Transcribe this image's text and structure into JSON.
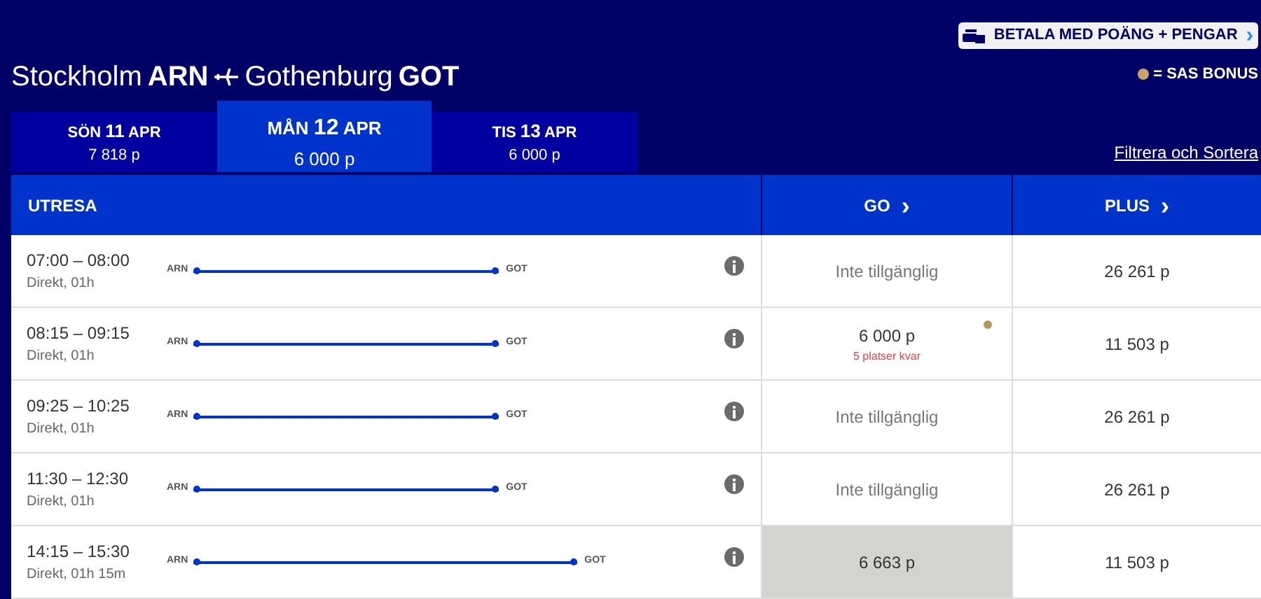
{
  "pay_button": {
    "label": "BETALA MED POÄNG + PENGAR",
    "chevron": "›"
  },
  "bonus_legend": {
    "label": "= SAS BONUS"
  },
  "route": {
    "origin_city": "Stockholm",
    "origin_code": "ARN",
    "destination_city": "Gothenburg",
    "destination_code": "GOT"
  },
  "date_tabs": [
    {
      "day": "SÖN",
      "date": "11",
      "month": "APR",
      "price": "7 818 p",
      "selected": false
    },
    {
      "day": "MÅN",
      "date": "12",
      "month": "APR",
      "price": "6 000 p",
      "selected": true
    },
    {
      "day": "TIS",
      "date": "13",
      "month": "APR",
      "price": "6 000 p",
      "selected": false
    }
  ],
  "filter_link": "Filtrera och Sortera",
  "table": {
    "columns": [
      {
        "label": "UTRESA"
      },
      {
        "label": "GO",
        "chevron": "›"
      },
      {
        "label": "PLUS",
        "chevron": "›"
      }
    ],
    "rows": [
      {
        "time": "07:00 – 08:00",
        "info": "Direkt, 01h",
        "from": "ARN",
        "to": "GOT",
        "kind": "short",
        "go": {
          "text": "Inte tillgänglig",
          "available": false,
          "selected": false,
          "bonus": false
        },
        "plus": "26 261 p"
      },
      {
        "time": "08:15 – 09:15",
        "info": "Direkt, 01h",
        "from": "ARN",
        "to": "GOT",
        "kind": "short",
        "go": {
          "text": "6 000 p",
          "available": true,
          "selected": false,
          "bonus": true,
          "note": "5 platser kvar"
        },
        "plus": "11 503 p"
      },
      {
        "time": "09:25 – 10:25",
        "info": "Direkt, 01h",
        "from": "ARN",
        "to": "GOT",
        "kind": "short",
        "go": {
          "text": "Inte tillgänglig",
          "available": false,
          "selected": false,
          "bonus": false
        },
        "plus": "26 261 p"
      },
      {
        "time": "11:30 – 12:30",
        "info": "Direkt, 01h",
        "from": "ARN",
        "to": "GOT",
        "kind": "short",
        "go": {
          "text": "Inte tillgänglig",
          "available": false,
          "selected": false,
          "bonus": false
        },
        "plus": "26 261 p"
      },
      {
        "time": "14:15 – 15:30",
        "info": "Direkt, 01h 15m",
        "from": "ARN",
        "to": "GOT",
        "kind": "long",
        "go": {
          "text": "6 663 p",
          "available": true,
          "selected": true,
          "bonus": false
        },
        "plus": "11 503 p"
      }
    ]
  }
}
